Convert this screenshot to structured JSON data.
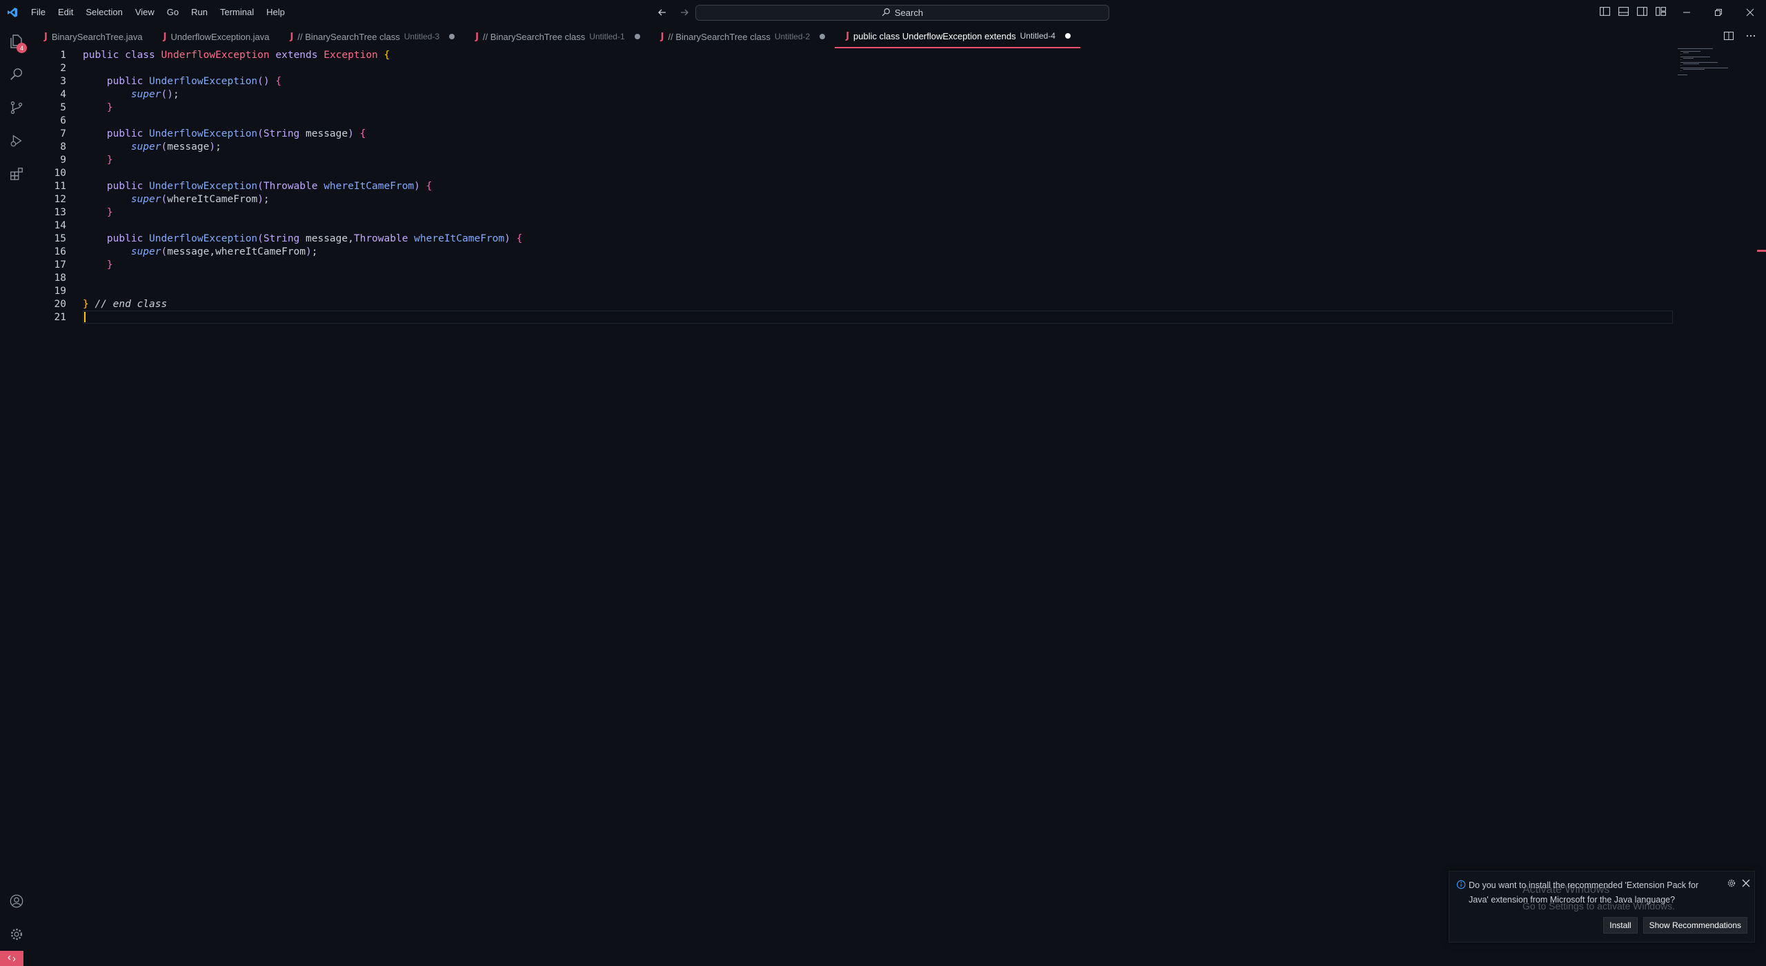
{
  "menu": [
    "File",
    "Edit",
    "Selection",
    "View",
    "Go",
    "Run",
    "Terminal",
    "Help"
  ],
  "search": {
    "label": "Search"
  },
  "activity": {
    "badge": "4"
  },
  "tabs": [
    {
      "name": "BinarySearchTree.java",
      "desc": "",
      "dirty": false,
      "active": false
    },
    {
      "name": "UnderflowException.java",
      "desc": "",
      "dirty": false,
      "active": false
    },
    {
      "name": "// BinarySearchTree class",
      "desc": "Untitled-3",
      "dirty": true,
      "active": false
    },
    {
      "name": "// BinarySearchTree class",
      "desc": "Untitled-1",
      "dirty": true,
      "active": false
    },
    {
      "name": "// BinarySearchTree class",
      "desc": "Untitled-2",
      "dirty": true,
      "active": false
    },
    {
      "name": "public class UnderflowException extends",
      "desc": "Untitled-4",
      "dirty": true,
      "active": true
    }
  ],
  "tab_icon": "J",
  "editor": {
    "line_numbers": [
      "1",
      "2",
      "3",
      "4",
      "5",
      "6",
      "7",
      "8",
      "9",
      "10",
      "11",
      "12",
      "13",
      "14",
      "15",
      "16",
      "17",
      "18",
      "19",
      "20",
      "21"
    ],
    "current_line": "21",
    "lines": [
      [
        [
          "kw",
          "public class "
        ],
        [
          "cls",
          "UnderflowException "
        ],
        [
          "kw",
          "extends "
        ],
        [
          "cls",
          "Exception "
        ],
        [
          "gold",
          "{"
        ]
      ],
      [],
      [
        [
          "txt",
          "    "
        ],
        [
          "kw",
          "public "
        ],
        [
          "fn",
          "UnderflowException"
        ],
        [
          "par",
          "() "
        ],
        [
          "br",
          "{"
        ]
      ],
      [
        [
          "txt",
          "        "
        ],
        [
          "sup",
          "super"
        ],
        [
          "par",
          "()"
        ],
        [
          "txt",
          ";"
        ]
      ],
      [
        [
          "txt",
          "    "
        ],
        [
          "br",
          "}"
        ]
      ],
      [],
      [
        [
          "txt",
          "    "
        ],
        [
          "kw",
          "public "
        ],
        [
          "fn",
          "UnderflowException"
        ],
        [
          "par",
          "(String "
        ],
        [
          "txt",
          "message"
        ],
        [
          "par",
          ") "
        ],
        [
          "br",
          "{"
        ]
      ],
      [
        [
          "txt",
          "        "
        ],
        [
          "sup",
          "super"
        ],
        [
          "par",
          "("
        ],
        [
          "txt",
          "message"
        ],
        [
          "par",
          ")"
        ],
        [
          "txt",
          ";"
        ]
      ],
      [
        [
          "txt",
          "    "
        ],
        [
          "br",
          "}"
        ]
      ],
      [],
      [
        [
          "txt",
          "    "
        ],
        [
          "kw",
          "public "
        ],
        [
          "fn",
          "UnderflowException"
        ],
        [
          "par",
          "(Throwable "
        ],
        [
          "fn",
          "whereItCameFrom"
        ],
        [
          "par",
          ") "
        ],
        [
          "br",
          "{"
        ]
      ],
      [
        [
          "txt",
          "        "
        ],
        [
          "sup",
          "super"
        ],
        [
          "par",
          "("
        ],
        [
          "txt",
          "whereItCameFrom"
        ],
        [
          "par",
          ")"
        ],
        [
          "txt",
          ";"
        ]
      ],
      [
        [
          "txt",
          "    "
        ],
        [
          "br",
          "}"
        ]
      ],
      [],
      [
        [
          "txt",
          "    "
        ],
        [
          "kw",
          "public "
        ],
        [
          "fn",
          "UnderflowException"
        ],
        [
          "par",
          "(String "
        ],
        [
          "txt",
          "message,"
        ],
        [
          "par",
          "Throwable "
        ],
        [
          "fn",
          "whereItCameFrom"
        ],
        [
          "par",
          ") "
        ],
        [
          "br",
          "{"
        ]
      ],
      [
        [
          "txt",
          "        "
        ],
        [
          "sup",
          "super"
        ],
        [
          "par",
          "("
        ],
        [
          "txt",
          "message,whereItCameFrom"
        ],
        [
          "par",
          ")"
        ],
        [
          "txt",
          ";"
        ]
      ],
      [
        [
          "txt",
          "    "
        ],
        [
          "br",
          "}"
        ]
      ],
      [],
      [],
      [
        [
          "gold",
          "} "
        ],
        [
          "cmt",
          "// end class"
        ]
      ],
      []
    ]
  },
  "notification": {
    "message": "Do you want to install the recommended 'Extension Pack for Java' extension from Microsoft for the Java language?",
    "install": "Install",
    "recommendations": "Show Recommendations"
  },
  "watermark": {
    "title": "Activate Windows",
    "subtitle": "Go to Settings to activate Windows."
  },
  "icons": [
    "vscode-logo-icon",
    "arrow-left-icon",
    "arrow-right-icon",
    "search-icon",
    "explorer-icon",
    "source-control-icon",
    "run-debug-icon",
    "extensions-icon",
    "account-icon",
    "settings-gear-icon",
    "info-icon",
    "close-icon",
    "split-editor-icon",
    "more-icon",
    "remote-icon"
  ]
}
